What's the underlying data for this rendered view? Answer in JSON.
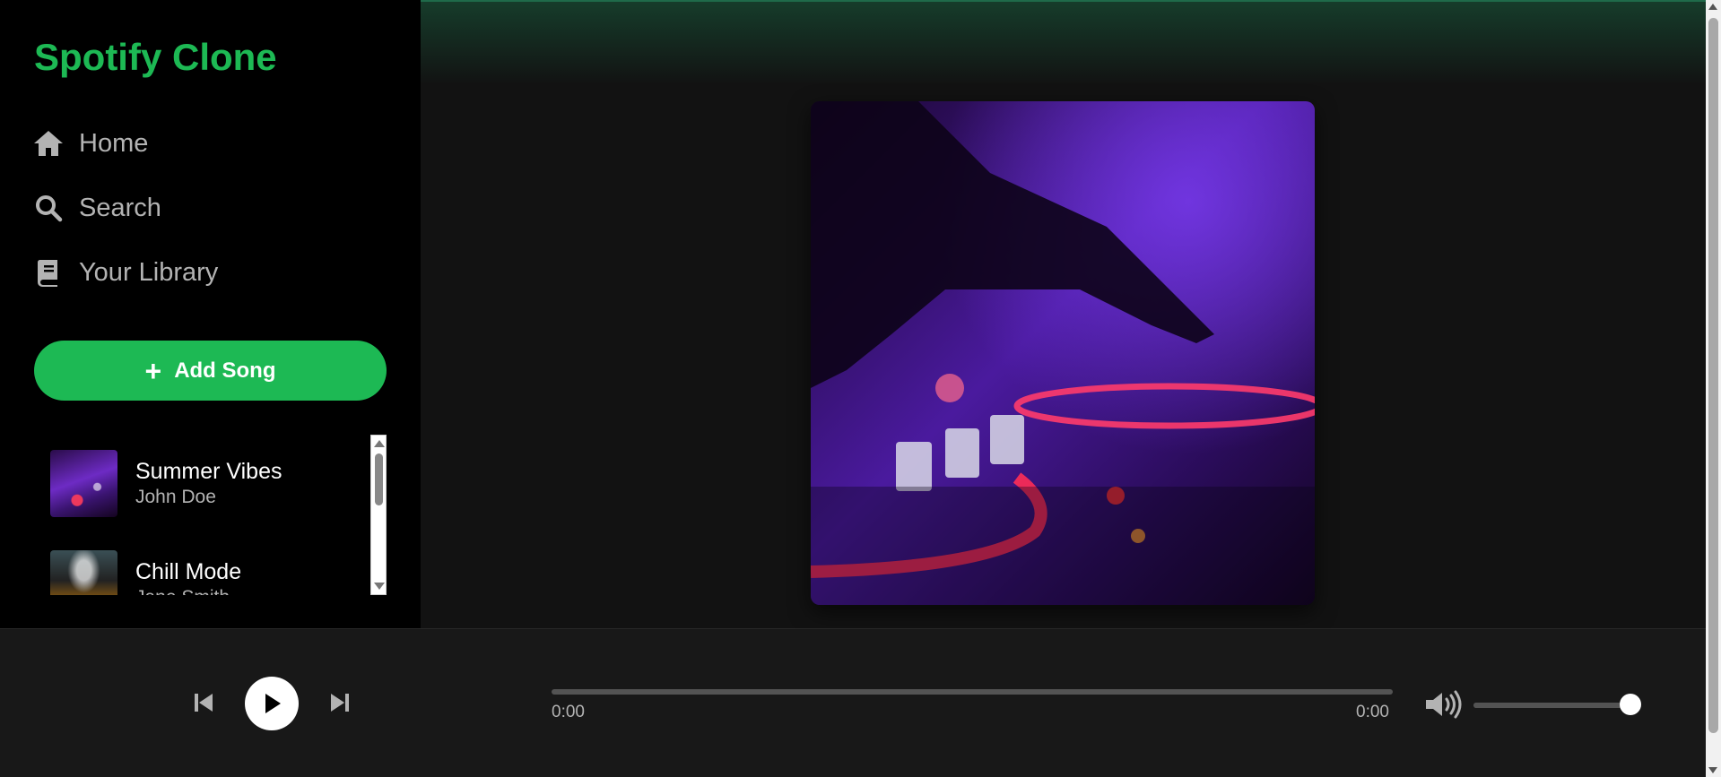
{
  "app": {
    "logo": "Spotify Clone"
  },
  "sidebar": {
    "nav": [
      {
        "label": "Home",
        "icon": "home-icon"
      },
      {
        "label": "Search",
        "icon": "search-icon"
      },
      {
        "label": "Your Library",
        "icon": "library-icon"
      }
    ],
    "add_song_label": "Add Song",
    "songs": [
      {
        "title": "Summer Vibes",
        "artist": "John Doe"
      },
      {
        "title": "Chill Mode",
        "artist": "Jane Smith"
      }
    ]
  },
  "player": {
    "current_time": "0:00",
    "duration": "0:00",
    "progress": 0,
    "volume": 1.0
  },
  "colors": {
    "accent": "#1db954",
    "background": "#121212",
    "sidebar": "#000000",
    "player": "#181818"
  }
}
